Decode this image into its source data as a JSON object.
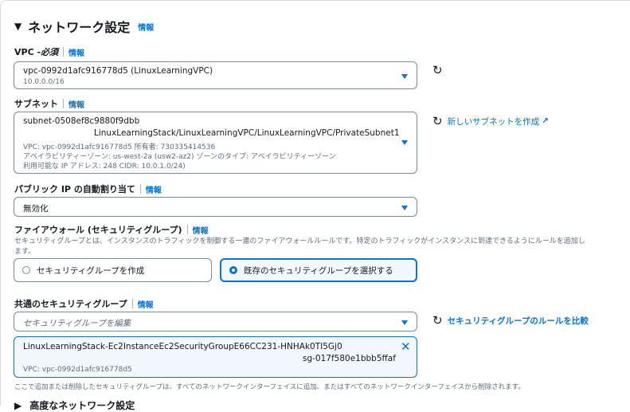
{
  "section": {
    "title": "ネットワーク設定",
    "info": "情報"
  },
  "vpc": {
    "label": "VPC - ",
    "required": "必須",
    "info": "情報",
    "value": "vpc-0992d1afc916778d5 (LinuxLearningVPC)",
    "cidr": "10.0.0.0/16"
  },
  "subnet": {
    "label": "サブネット",
    "info": "情報",
    "id": "subnet-0508ef8c9880f9dbb",
    "name": "LinuxLearningStack/LinuxLearningVPC/LinuxLearningVPC/PrivateSubnet1",
    "line1": "VPC: vpc-0992d1afc916778d5    所有者: 730335414536",
    "line2": "アベイラビリティーゾーン: us-west-2a (usw2-az2)    ゾーンのタイプ: アベイラビリティーゾーン",
    "line3": "利用可能な IP アドレス: 248    CIDR: 10.0.1.0/24)",
    "create_link": "新しいサブネットを作成"
  },
  "public_ip": {
    "label": "パブリック IP の自動割り当て",
    "info": "情報",
    "value": "無効化"
  },
  "firewall": {
    "label": "ファイアウォール (セキュリティグループ)",
    "info": "情報",
    "desc1": "セキュリティグループとは、インスタンスのトラフィックを制御する一連のファイアウォールルールです。特定のトラフィックがインスタンスに到達できるようにルールを追加し",
    "desc2": "ます。",
    "option_create": "セキュリティグループを作成",
    "option_existing": "既存のセキュリティグループを選択する"
  },
  "common_sg": {
    "label": "共通のセキュリティグループ",
    "info": "情報",
    "placeholder": "セキュリティグループを編集",
    "compare_link": "セキュリティグループのルールを比較",
    "token_name": "LinuxLearningStack-Ec2InstanceEc2SecurityGroupE66CC231-HNHAk0TI5Gj0",
    "token_id": "sg-017f580e1bbb5ffaf",
    "token_vpc": "VPC: vpc-0992d1afc916778d5",
    "note": "ここで追加または削除したセキュリティグループは、すべてのネットワークインターフェイスに追加、またはすべてのネットワークインターフェイスから削除されます。"
  },
  "next_section": {
    "title": "高度なネットワーク設定"
  }
}
